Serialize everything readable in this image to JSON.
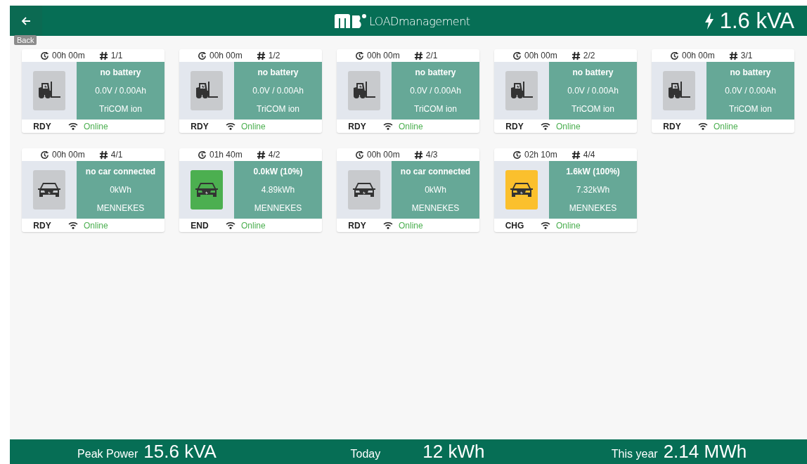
{
  "header": {
    "back_tooltip": "Back",
    "logo_text": "LOADmanagement",
    "power": "1.6 kVA"
  },
  "chargers": [
    {
      "kind": "forklift",
      "time": "00h 00m",
      "number": "1/1",
      "color": "#c8cacd",
      "line_1": "no battery",
      "line_2": "0.0V / 0.00Ah",
      "line_3": "TriCOM ion",
      "status": "RDY",
      "connection": "Online"
    },
    {
      "kind": "forklift",
      "time": "00h 00m",
      "number": "1/2",
      "color": "#c8cacd",
      "line_1": "no battery",
      "line_2": "0.0V / 0.00Ah",
      "line_3": "TriCOM ion",
      "status": "RDY",
      "connection": "Online"
    },
    {
      "kind": "forklift",
      "time": "00h 00m",
      "number": "2/1",
      "color": "#c8cacd",
      "line_1": "no battery",
      "line_2": "0.0V / 0.00Ah",
      "line_3": "TriCOM ion",
      "status": "RDY",
      "connection": "Online"
    },
    {
      "kind": "forklift",
      "time": "00h 00m",
      "number": "2/2",
      "color": "#c8cacd",
      "line_1": "no battery",
      "line_2": "0.0V / 0.00Ah",
      "line_3": "TriCOM ion",
      "status": "RDY",
      "connection": "Online"
    },
    {
      "kind": "forklift",
      "time": "00h 00m",
      "number": "3/1",
      "color": "#c8cacd",
      "line_1": "no battery",
      "line_2": "0.0V / 0.00Ah",
      "line_3": "TriCOM ion",
      "status": "RDY",
      "connection": "Online"
    },
    {
      "kind": "car",
      "time": "00h 00m",
      "number": "4/1",
      "color": "#c8cacd",
      "line_1": "no car connected",
      "line_2": "0kWh",
      "line_3": "MENNEKES",
      "status": "RDY",
      "connection": "Online"
    },
    {
      "kind": "car",
      "time": "01h 40m",
      "number": "4/2",
      "color": "#4caf50",
      "line_1": "0.0kW (10%)",
      "line_2": "4.89kWh",
      "line_3": "MENNEKES",
      "status": "END",
      "connection": "Online"
    },
    {
      "kind": "car",
      "time": "00h 00m",
      "number": "4/3",
      "color": "#c8cacd",
      "line_1": "no car connected",
      "line_2": "0kWh",
      "line_3": "MENNEKES",
      "status": "RDY",
      "connection": "Online"
    },
    {
      "kind": "car",
      "time": "02h 10m",
      "number": "4/4",
      "color": "#fbc02d",
      "line_1": "1.6kW (100%)",
      "line_2": "7.32kWh",
      "line_3": "MENNEKES",
      "status": "CHG",
      "connection": "Online"
    }
  ],
  "footer": [
    {
      "label": "Peak Power",
      "value": "15.6 kVA"
    },
    {
      "label": "Today",
      "value": "12 kWh"
    },
    {
      "label": "This year",
      "value": "2.14 MWh"
    }
  ]
}
